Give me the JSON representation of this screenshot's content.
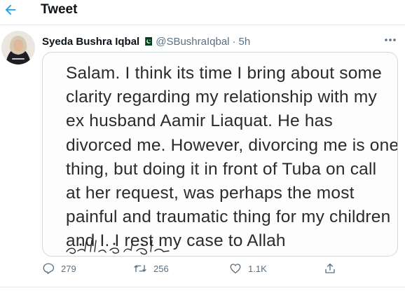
{
  "header": {
    "title": "Tweet",
    "back_icon": "arrow-left-icon",
    "accent_color": "#1da1f2"
  },
  "tweet": {
    "author_name": "Syeda Bushra Iqbal",
    "flag_icon": "pakistan-flag-icon",
    "handle": "@SBushraIqbal",
    "separator": "·",
    "time": "5h",
    "more_icon": "more-horizontal-icon",
    "image_text_lines": [
      "Salam. I think its time I bring about some",
      "clarity regarding my relationship with my",
      "ex husband Aamir Liaquat. He has",
      "divorced me. However, divorcing me is one",
      "thing, but doing it in front of Tuba on call",
      "at her request, was perhaps the most",
      "painful and traumatic thing for my children",
      "and I. I rest my case to Allah"
    ],
    "handwritten_line": "حسبی اللہ و نعم الوکیل"
  },
  "actions": {
    "reply": {
      "icon": "reply-icon",
      "count": "279"
    },
    "retweet": {
      "icon": "retweet-icon",
      "count": "256"
    },
    "like": {
      "icon": "heart-icon",
      "count": "1.1K"
    },
    "share": {
      "icon": "share-icon"
    }
  }
}
